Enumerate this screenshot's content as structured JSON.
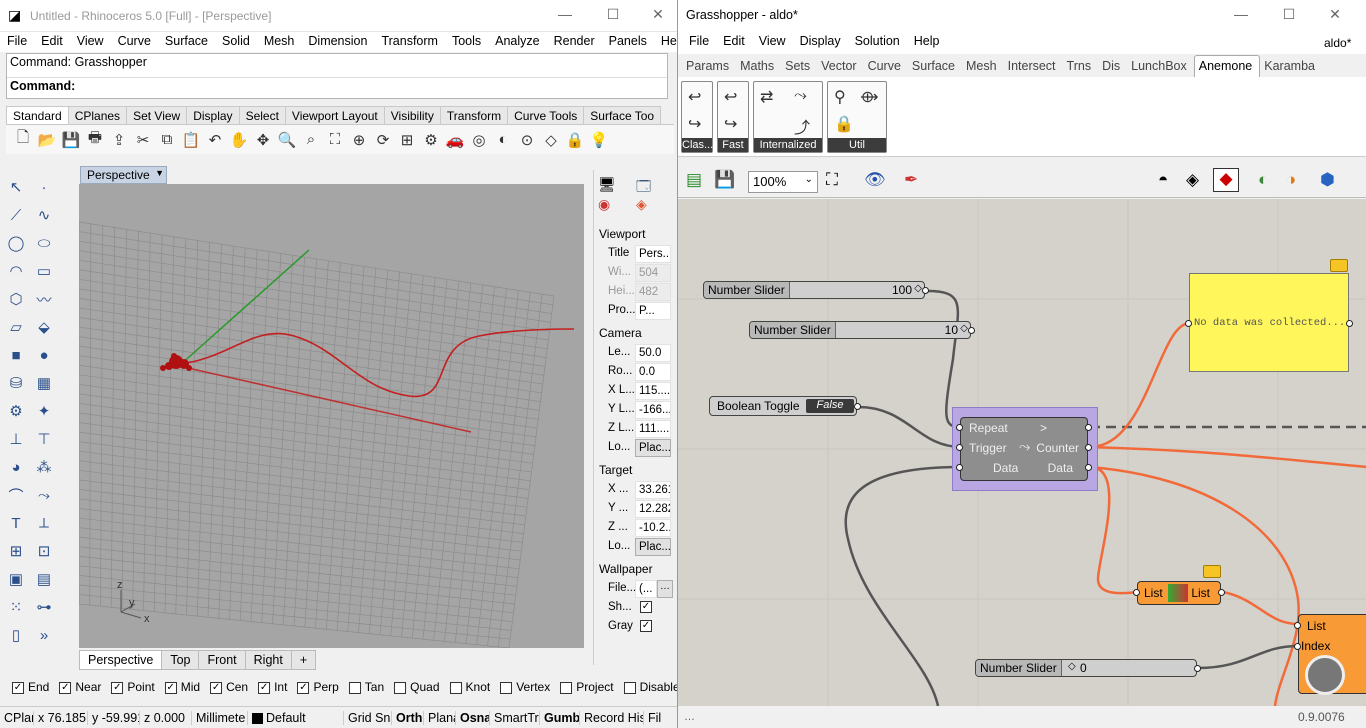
{
  "rhino": {
    "title": "Untitled - Rhinoceros 5.0 [Full] - [Perspective]",
    "menu": [
      "File",
      "Edit",
      "View",
      "Curve",
      "Surface",
      "Solid",
      "Mesh",
      "Dimension",
      "Transform",
      "Tools",
      "Analyze",
      "Render",
      "Panels",
      "Help"
    ],
    "command_history": "Command: Grasshopper",
    "command_prompt": "Command:",
    "toolbar_tabs": [
      "Standard",
      "CPlanes",
      "Set View",
      "Display",
      "Select",
      "Viewport Layout",
      "Visibility",
      "Transform",
      "Curve Tools",
      "Surface Too"
    ],
    "viewport_title": "Perspective",
    "viewport_tabs": [
      "Perspective",
      "Top",
      "Front",
      "Right"
    ],
    "axis_labels": {
      "z": "z",
      "y": "y",
      "x": "x"
    },
    "properties": {
      "viewport_section": "Viewport",
      "title_k": "Title",
      "title_v": "Pers...",
      "width_k": "Wi...",
      "width_v": "504",
      "height_k": "Hei...",
      "height_v": "482",
      "proj_k": "Pro...",
      "proj_v": "P...",
      "camera_section": "Camera",
      "lens_k": "Le...",
      "lens_v": "50.0",
      "rot_k": "Ro...",
      "rot_v": "0.0",
      "xl_k": "X L...",
      "xl_v": "115....",
      "yl_k": "Y L...",
      "yl_v": "-166....",
      "zl_k": "Z L...",
      "zl_v": "111....",
      "loc_k": "Lo...",
      "loc_v": "Plac...",
      "target_section": "Target",
      "tx_k": "X ...",
      "tx_v": "33.261",
      "ty_k": "Y ...",
      "ty_v": "12.282",
      "tz_k": "Z ...",
      "tz_v": "-10.2...",
      "tloc_k": "Lo...",
      "tloc_v": "Plac...",
      "wallpaper_section": "Wallpaper",
      "file_k": "File...",
      "file_v": "(...",
      "show_k": "Sh...",
      "gray_k": "Gray"
    },
    "osnaps": [
      {
        "label": "End",
        "checked": true
      },
      {
        "label": "Near",
        "checked": true
      },
      {
        "label": "Point",
        "checked": true
      },
      {
        "label": "Mid",
        "checked": true
      },
      {
        "label": "Cen",
        "checked": true
      },
      {
        "label": "Int",
        "checked": true
      },
      {
        "label": "Perp",
        "checked": true
      },
      {
        "label": "Tan",
        "checked": false
      },
      {
        "label": "Quad",
        "checked": false
      },
      {
        "label": "Knot",
        "checked": false
      },
      {
        "label": "Vertex",
        "checked": false
      },
      {
        "label": "Project",
        "checked": false
      },
      {
        "label": "Disable",
        "checked": false
      }
    ],
    "status": {
      "cplane": "CPlan",
      "x": "x 76.185",
      "y": "y -59.991",
      "z": "z 0.000",
      "units": "Millimete",
      "layer": "Default",
      "grid": "Grid Sn",
      "ortho": "Orth",
      "planar": "Plana",
      "osnap": "Osna",
      "smarttrack": "SmartTr",
      "gumball": "Gumb",
      "history": "Record His",
      "filter": "Fil"
    }
  },
  "grasshopper": {
    "title": "Grasshopper - aldo*",
    "doc_name": "aldo*",
    "menu": [
      "File",
      "Edit",
      "View",
      "Display",
      "Solution",
      "Help"
    ],
    "tabs": [
      "Params",
      "Maths",
      "Sets",
      "Vector",
      "Curve",
      "Surface",
      "Mesh",
      "Intersect",
      "Trns",
      "Dis",
      "LunchBox",
      "Anemone",
      "Karamba"
    ],
    "active_tab": "Anemone",
    "panels": [
      "Clas...",
      "Fast",
      "Internalized",
      "Util"
    ],
    "zoom": "100%",
    "components": {
      "slider1_name": "Number Slider",
      "slider1_value": "100",
      "slider2_name": "Number Slider",
      "slider2_value": "10",
      "toggle_name": "Boolean Toggle",
      "toggle_value": "False",
      "loop_in1": "Repeat",
      "loop_in2": "Trigger",
      "loop_in3": "Data",
      "loop_out1": ">",
      "loop_out2": "Counter",
      "loop_out3": "Data",
      "panel_text": "No data was collected...",
      "list_in": "List",
      "list_out": "List",
      "item_in1": "List",
      "item_in2": "Index",
      "slider3_name": "Number Slider",
      "slider3_value": "0"
    },
    "version": "0.9.0076"
  },
  "colors": {
    "wire": "#555555",
    "wire_selected": "#f26a3a",
    "panel_yellow": "#fff65c",
    "loop_purple": "#b9a7e3",
    "component_orange": "#f89a36"
  }
}
